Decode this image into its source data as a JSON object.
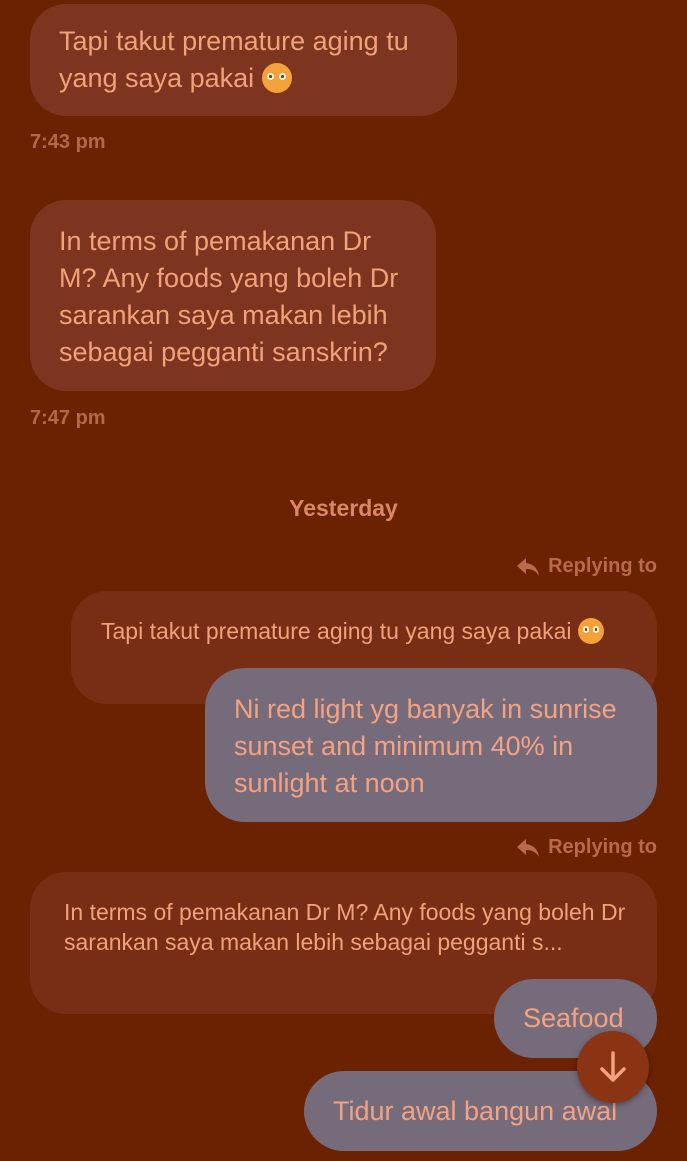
{
  "messages": {
    "m1": {
      "text": "Tapi takut premature aging tu yang saya pakai",
      "emoji": "pleading-face",
      "time": "7:43 pm"
    },
    "m2": {
      "text": "In terms of pemakanan Dr M? Any foods yang boleh Dr sarankan saya makan lebih sebagai pegganti sanskrin?",
      "time": "7:47 pm"
    }
  },
  "date_separator": "Yesterday",
  "replies": {
    "r1": {
      "label": "Replying to",
      "quote": "Tapi takut premature aging tu yang saya pakai",
      "quote_emoji": "pleading-face",
      "text": "Ni red light yg banyak in sunrise sunset and minimum 40% in sunlight at noon"
    },
    "r2": {
      "label": "Replying to",
      "quote": "In terms of pemakanan Dr M? Any foods yang boleh Dr sarankan saya makan lebih sebagai pegganti s...",
      "text": "Seafood"
    }
  },
  "last_message": "Tidur awal bangun awal",
  "icons": {
    "reply": "reply-arrow-icon",
    "scroll": "arrow-down-icon"
  },
  "colors": {
    "background": "#6a2200",
    "incoming_bubble": "#7d3520",
    "outgoing_bubble": "#766b7b",
    "text": "#f0a27a"
  }
}
